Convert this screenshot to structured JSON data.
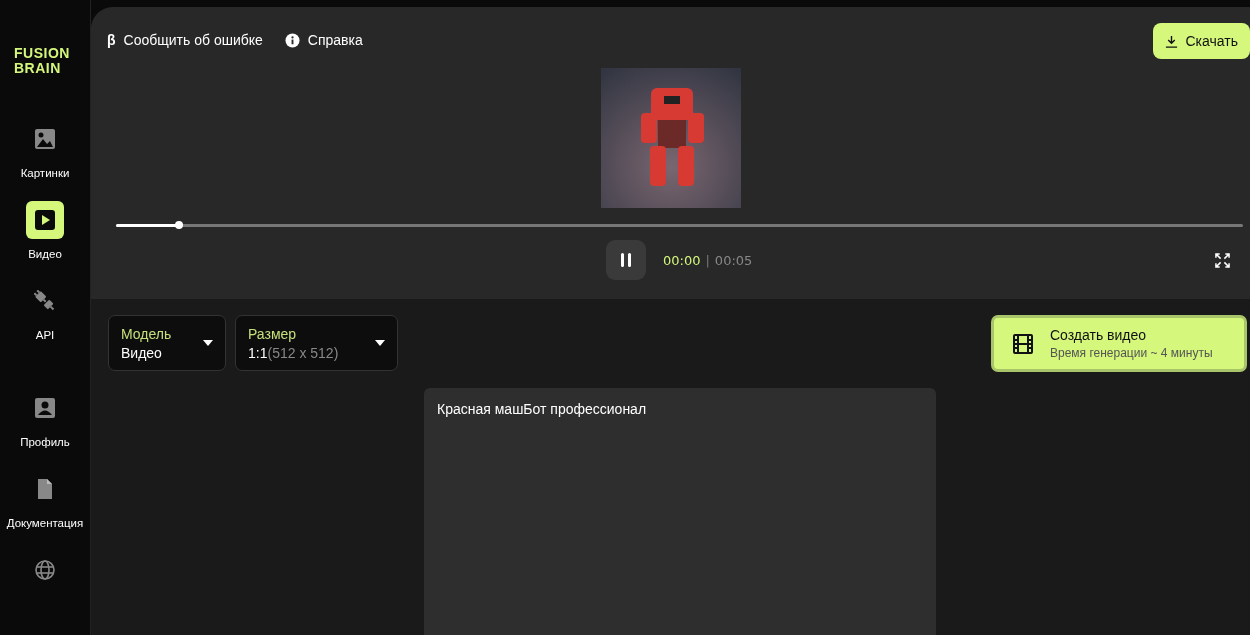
{
  "logo": "FUSION BRAIN",
  "sidebar": {
    "items": [
      {
        "label": "Картинки",
        "selected": false
      },
      {
        "label": "Видео",
        "selected": true
      },
      {
        "label": "API",
        "selected": false
      },
      {
        "label": "Профиль",
        "selected": false
      },
      {
        "label": "Документация",
        "selected": false
      },
      {
        "selected": false
      }
    ]
  },
  "top_links": [
    {
      "icon_text": "β",
      "label": "Сообщить об ошибке"
    },
    {
      "label": "Справка"
    }
  ],
  "download_button": "Скачать",
  "player": {
    "level": 0.056,
    "current_time": "00:00",
    "separator": "|",
    "duration": "00:05",
    "playing": true
  },
  "selects": [
    {
      "label": "Модель",
      "value": "Видео"
    },
    {
      "label": "Размер",
      "value": "1:1",
      "hint": "(512 x 512)"
    }
  ],
  "create_button": {
    "title": "Создать видео",
    "subtitle": "Время генерации ~ 4 минуты"
  },
  "prompt": {
    "value": "Красная машБот профессионал"
  }
}
